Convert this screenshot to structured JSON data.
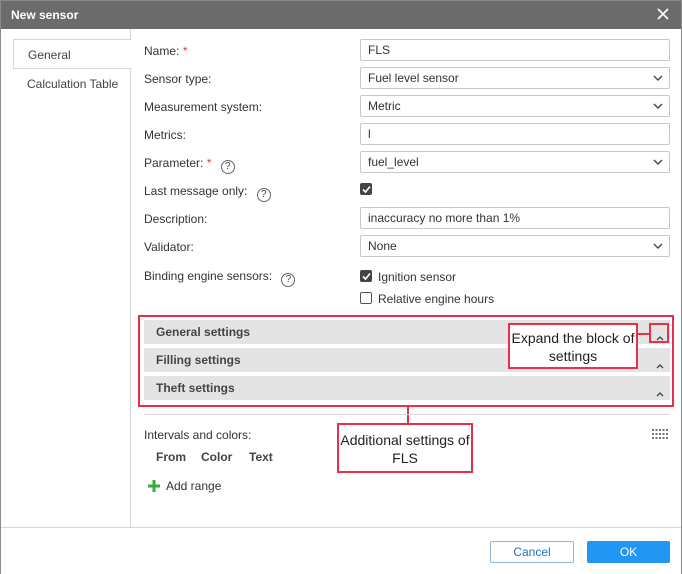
{
  "dialog": {
    "title": "New sensor"
  },
  "tabs": [
    {
      "label": "General",
      "active": true
    },
    {
      "label": "Calculation Table",
      "active": false
    }
  ],
  "form": {
    "name": {
      "label": "Name:",
      "required": "*",
      "value": "FLS"
    },
    "sensor_type": {
      "label": "Sensor type:",
      "value": "Fuel level sensor"
    },
    "measurement_system": {
      "label": "Measurement system:",
      "value": "Metric"
    },
    "metrics": {
      "label": "Metrics:",
      "value": "l"
    },
    "parameter": {
      "label": "Parameter:",
      "required": "*",
      "value": "fuel_level"
    },
    "last_message_only": {
      "label": "Last message only:",
      "checked": true
    },
    "description": {
      "label": "Description:",
      "value": "inaccuracy no more than 1%"
    },
    "validator": {
      "label": "Validator:",
      "value": "None"
    },
    "binding": {
      "label": "Binding engine sensors:",
      "options": [
        {
          "label": "Ignition sensor",
          "checked": true
        },
        {
          "label": "Relative engine hours",
          "checked": false
        }
      ]
    }
  },
  "sections": [
    {
      "label": "General settings"
    },
    {
      "label": "Filling settings"
    },
    {
      "label": "Theft settings"
    }
  ],
  "annotations": {
    "expand_block": "Expand the block of settings",
    "additional_settings": "Additional settings of FLS",
    "color": "#e8304a"
  },
  "intervals": {
    "label": "Intervals and colors:",
    "columns": [
      "From",
      "Color",
      "Text"
    ],
    "add_range": "Add range"
  },
  "footer": {
    "cancel": "Cancel",
    "ok": "OK"
  },
  "colors": {
    "titlebar": "#6b6b6b",
    "primary": "#2196f3",
    "plus": "#3aa83a"
  }
}
